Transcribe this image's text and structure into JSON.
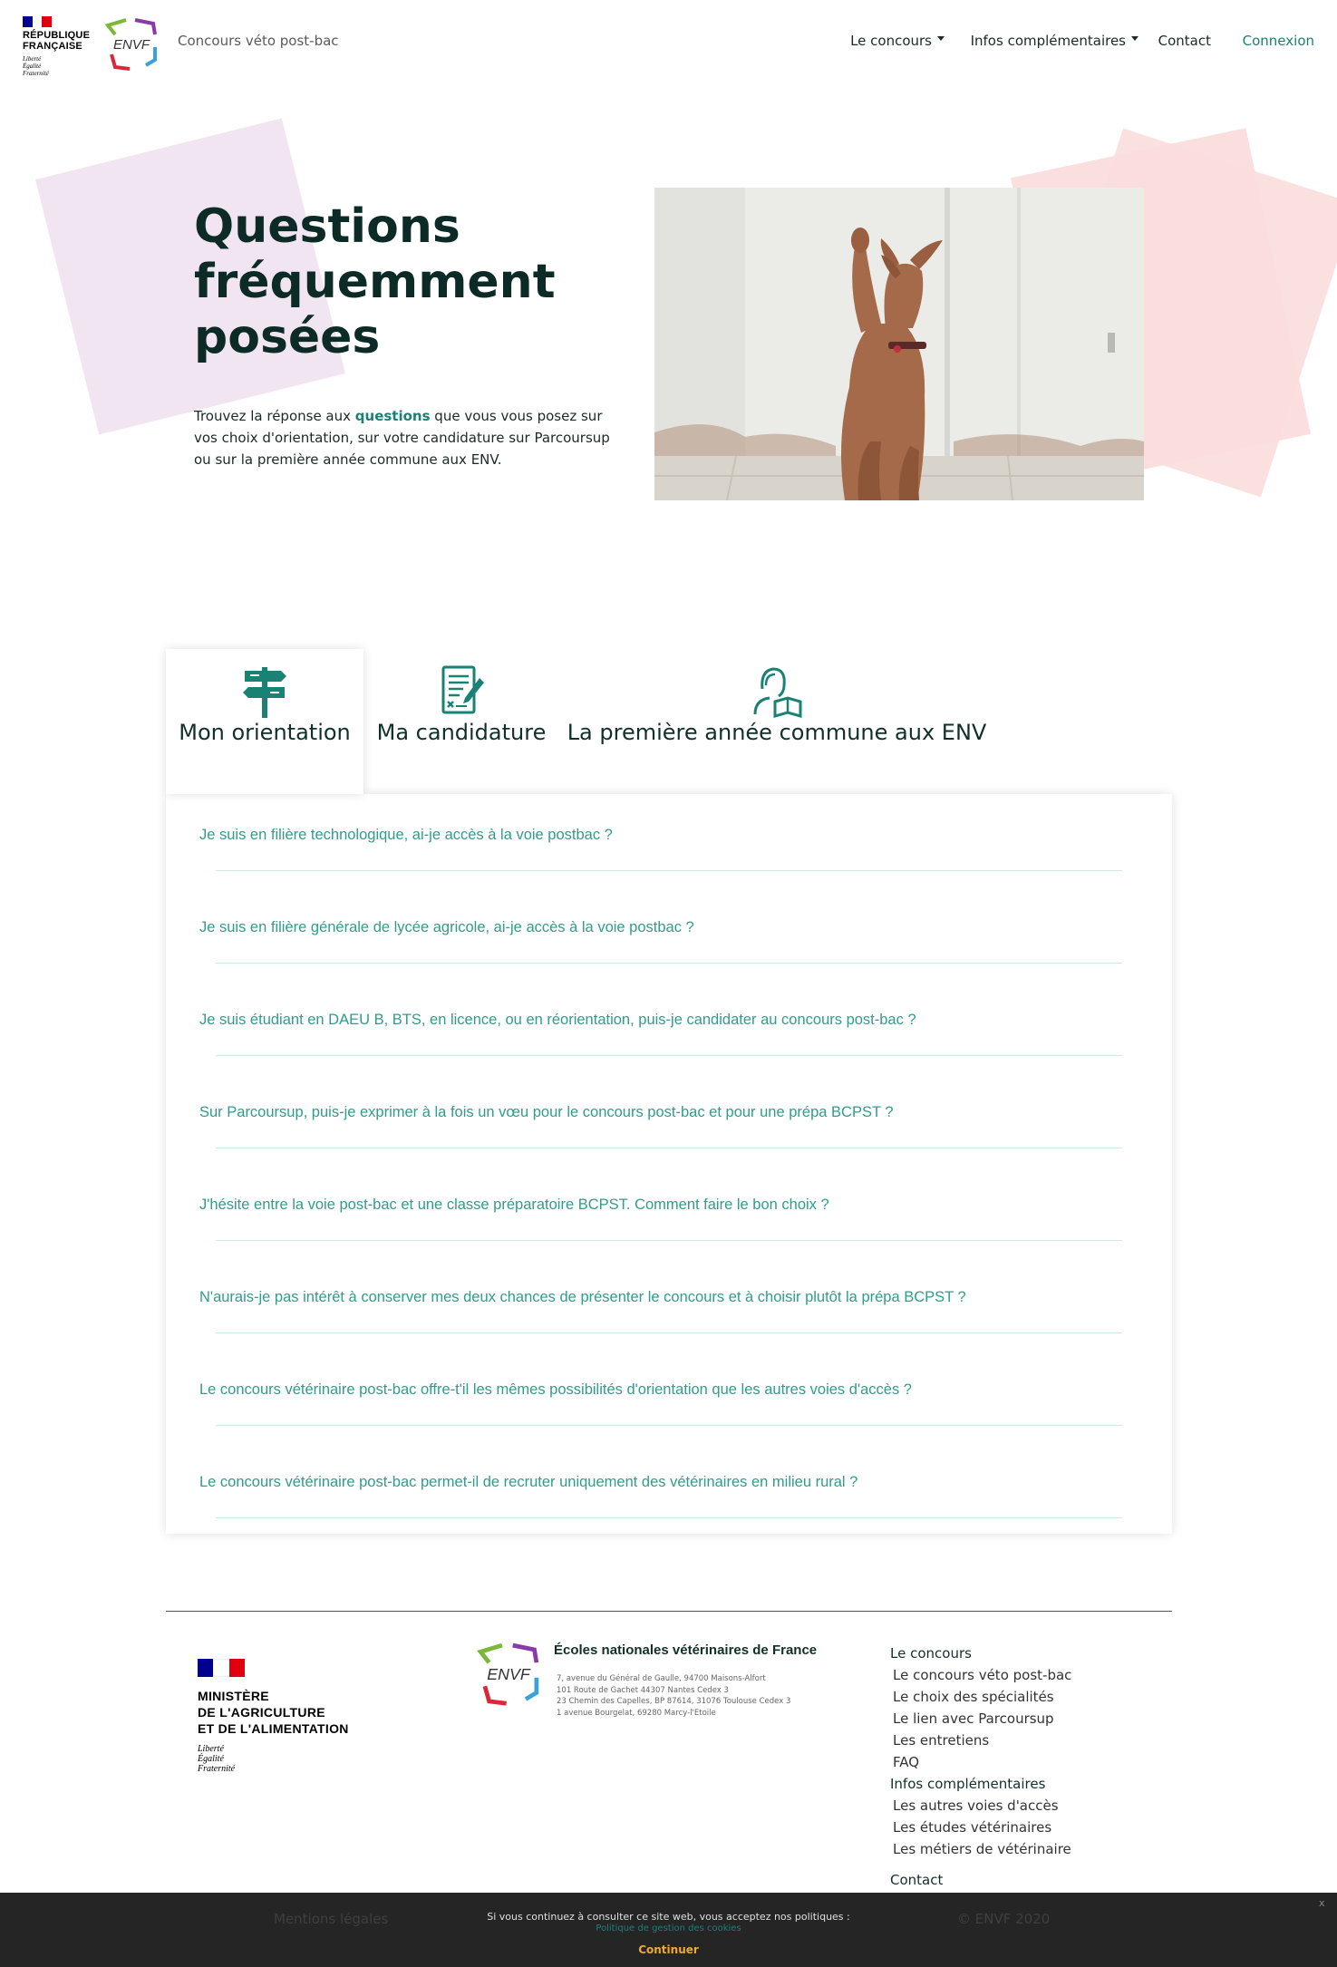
{
  "header": {
    "republique_title": "RÉPUBLIQUE FRANÇAISE",
    "republique_motto": [
      "Liberté",
      "Égalité",
      "Fraternité"
    ],
    "site_name": "Concours véto post-bac",
    "nav": {
      "concours": "Le concours",
      "infos": "Infos complémentaires",
      "contact": "Contact",
      "connexion": "Connexion"
    }
  },
  "hero": {
    "title_lines": [
      "Questions",
      "fréquemment",
      "posées"
    ],
    "intro_before": "Trouvez la réponse aux ",
    "intro_bold": "questions",
    "intro_after": " que vous vous posez sur vos choix d'orientation, sur votre candidature sur Parcoursup ou sur la première année commune aux ENV."
  },
  "tabs": [
    {
      "label": "Mon orientation",
      "icon": "signpost-icon",
      "active": true
    },
    {
      "label": "Ma candidature",
      "icon": "document-pen-icon",
      "active": false
    },
    {
      "label": "La première année commune aux ENV",
      "icon": "student-book-icon",
      "active": false
    }
  ],
  "faq": [
    "Je suis en filière technologique, ai-je accès à la voie postbac ?",
    "Je suis en filière générale de lycée agricole, ai-je accès à la voie postbac ?",
    "Je suis étudiant en DAEU B, BTS, en licence, ou en réorientation, puis-je candidater au concours post-bac ?",
    "Sur Parcoursup, puis-je exprimer à la fois un vœu pour le concours post-bac et pour une prépa BCPST ?",
    "J'hésite entre la voie post-bac et une classe préparatoire BCPST. Comment faire le bon choix ?",
    "N'aurais-je pas intérêt à conserver mes deux chances de présenter le concours et à choisir plutôt la prépa BCPST ?",
    "Le concours vétérinaire post-bac offre-t'il les mêmes possibilités d'orientation que les autres voies d'accès ?",
    "Le concours vétérinaire post-bac permet-il de recruter uniquement des vétérinaires en milieu rural ?"
  ],
  "footer": {
    "ministry_lines": [
      "MINISTÈRE",
      "DE L'AGRICULTURE",
      "ET DE L'ALIMENTATION"
    ],
    "ministry_motto": [
      "Liberté",
      "Égalité",
      "Fraternité"
    ],
    "org_name": "Écoles nationales vétérinaires de France",
    "addresses": [
      "7, avenue du Général de Gaulle, 94700 Maisons-Alfort",
      "101 Route de Gachet 44307 Nantes Cedex 3",
      "23 Chemin des Capelles, BP 87614, 31076 Toulouse Cedex 3",
      "1 avenue Bourgelat, 69280 Marcy-l'Etoile"
    ],
    "concours_head": "Le concours",
    "concours_links": [
      "Le concours véto post-bac",
      "Le choix des spécialités",
      "Le lien avec Parcoursup",
      "Les entretiens",
      "FAQ"
    ],
    "infos_head": "Infos complémentaires",
    "infos_links": [
      "Les autres voies d'accès",
      "Les études vétérinaires",
      "Les métiers de vétérinaire"
    ],
    "contact": "Contact",
    "mentions": "Mentions légales",
    "copyright": "© ENVF 2020"
  },
  "cookie": {
    "text": "Si vous continuez à consulter ce site web, vous acceptez nos politiques :",
    "policy_link": "Politique de gestion des cookies",
    "button": "Continuer",
    "close": "x"
  },
  "colors": {
    "accent": "#1a8275",
    "faq_text": "#2f9d8c",
    "title": "#0d2b26",
    "deco_purple": "#f1e5f1",
    "deco_pink": "#fbdcdc",
    "cookie_bg": "#252525",
    "cookie_button": "#f0a830",
    "flag_blue": "#000091",
    "flag_red": "#e1000f"
  }
}
